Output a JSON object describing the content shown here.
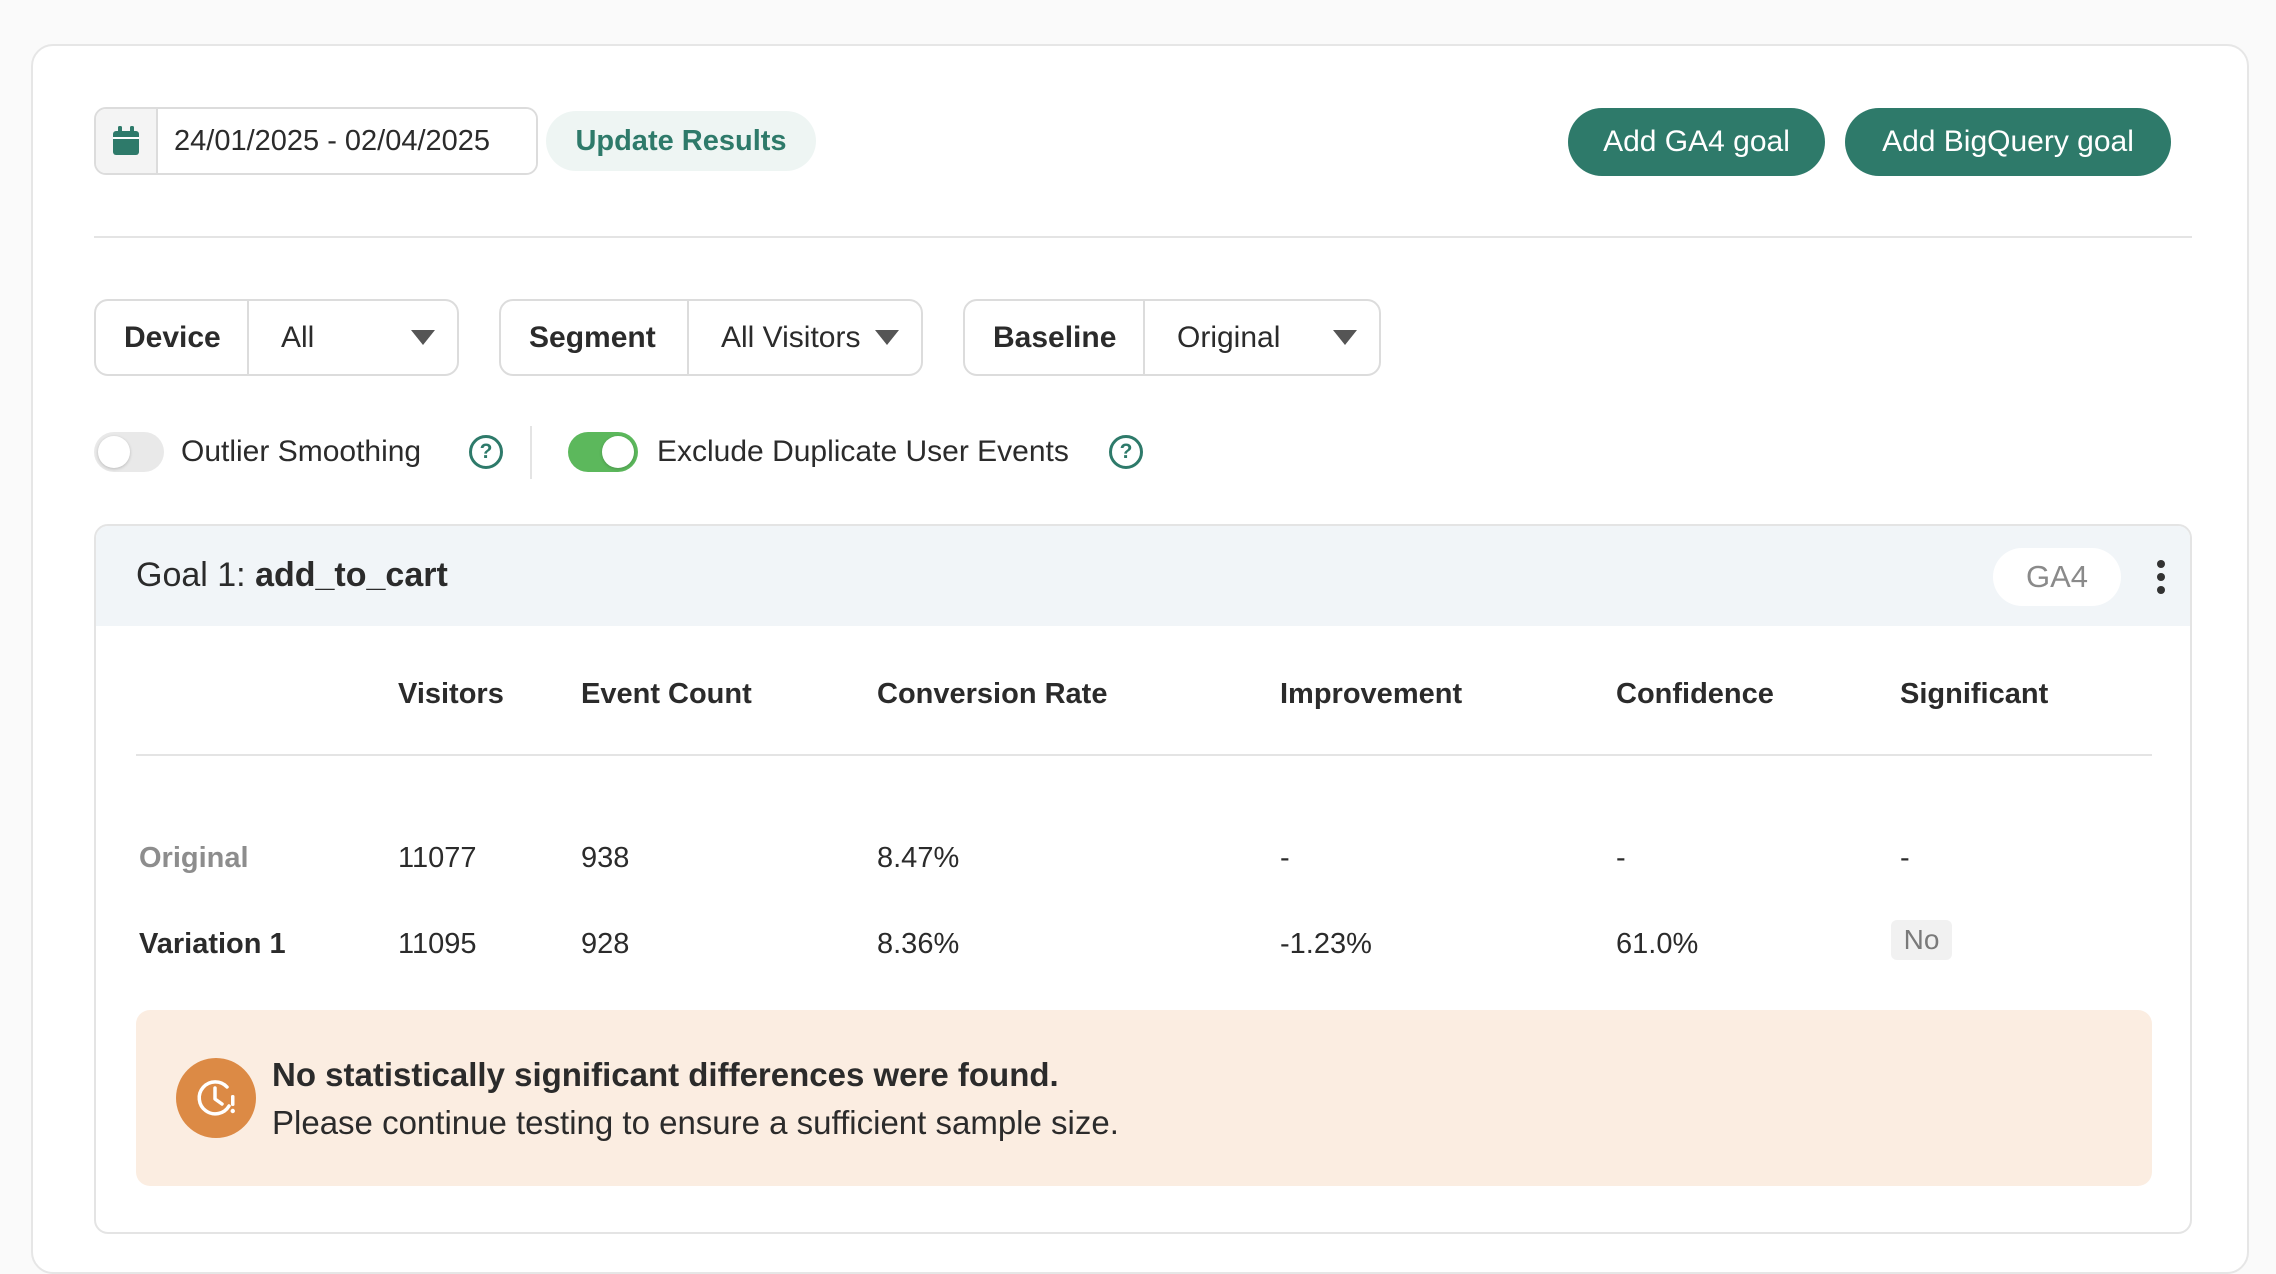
{
  "toolbar": {
    "date_range": "24/01/2025 - 02/04/2025",
    "update_label": "Update Results",
    "add_ga4_label": "Add GA4 goal",
    "add_bigquery_label": "Add BigQuery goal"
  },
  "filters": {
    "device": {
      "label": "Device",
      "value": "All"
    },
    "segment": {
      "label": "Segment",
      "value": "All Visitors"
    },
    "baseline": {
      "label": "Baseline",
      "value": "Original"
    }
  },
  "toggles": {
    "outlier_smoothing": {
      "label": "Outlier Smoothing",
      "enabled": false
    },
    "exclude_duplicates": {
      "label": "Exclude Duplicate User Events",
      "enabled": true
    },
    "help_glyph": "?"
  },
  "goal": {
    "prefix": "Goal 1: ",
    "name": "add_to_cart",
    "source_badge": "GA4",
    "columns": [
      "Visitors",
      "Event Count",
      "Conversion Rate",
      "Improvement",
      "Confidence",
      "Significant"
    ],
    "rows": [
      {
        "name": "Original",
        "visitors": "11077",
        "event_count": "938",
        "conversion_rate": "8.47%",
        "improvement": "-",
        "confidence": "-",
        "significant": "-"
      },
      {
        "name": "Variation 1",
        "visitors": "11095",
        "event_count": "928",
        "conversion_rate": "8.36%",
        "improvement": "-1.23%",
        "confidence": "61.0%",
        "significant": "No"
      }
    ],
    "alert": {
      "title": "No statistically significant differences were found.",
      "body": "Please continue testing to ensure a sufficient sample size."
    }
  },
  "colors": {
    "brand_green": "#2e7a6a",
    "toggle_on": "#5cb85c",
    "alert_bg": "#fbede1",
    "alert_icon": "#dc8a45"
  },
  "icons": {
    "date": "calendar-icon",
    "caret": "caret-down-icon",
    "help": "help-circle-icon",
    "menu": "kebab-menu-icon",
    "alert": "clock-alert-icon"
  }
}
